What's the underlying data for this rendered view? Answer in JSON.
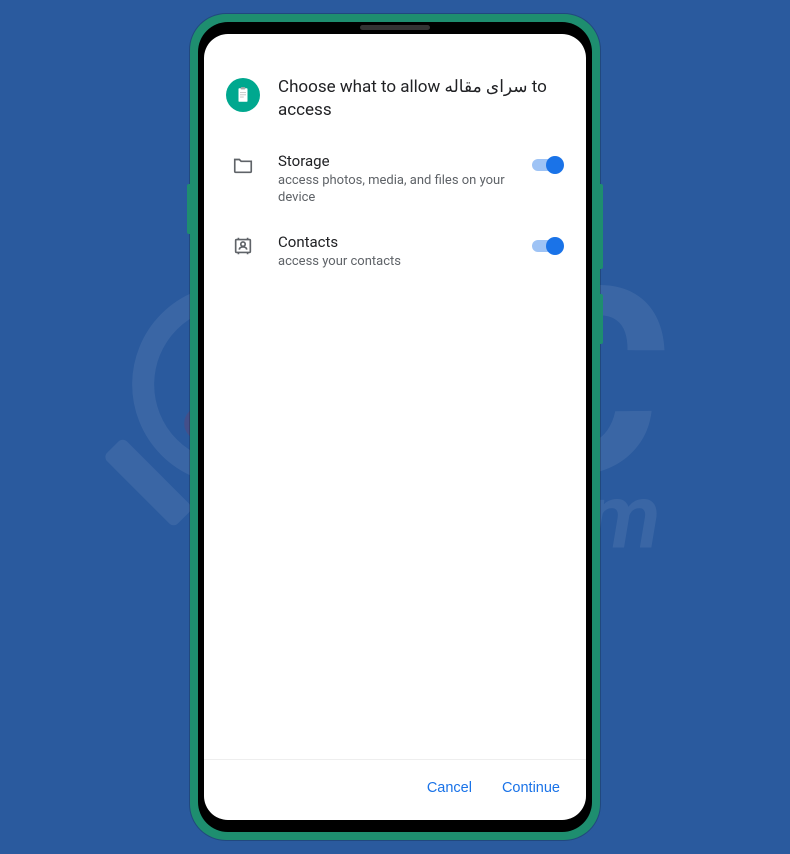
{
  "header": {
    "title": "Choose what to allow سرای مقاله to access"
  },
  "permissions": [
    {
      "name": "Storage",
      "description": "access photos, media, and files on your device",
      "enabled": true,
      "icon": "folder-icon"
    },
    {
      "name": "Contacts",
      "description": "access your contacts",
      "enabled": true,
      "icon": "contacts-icon"
    }
  ],
  "buttons": {
    "cancel": "Cancel",
    "continue": "Continue"
  },
  "watermark": {
    "line1": "PC",
    "line2": "risk.com"
  }
}
